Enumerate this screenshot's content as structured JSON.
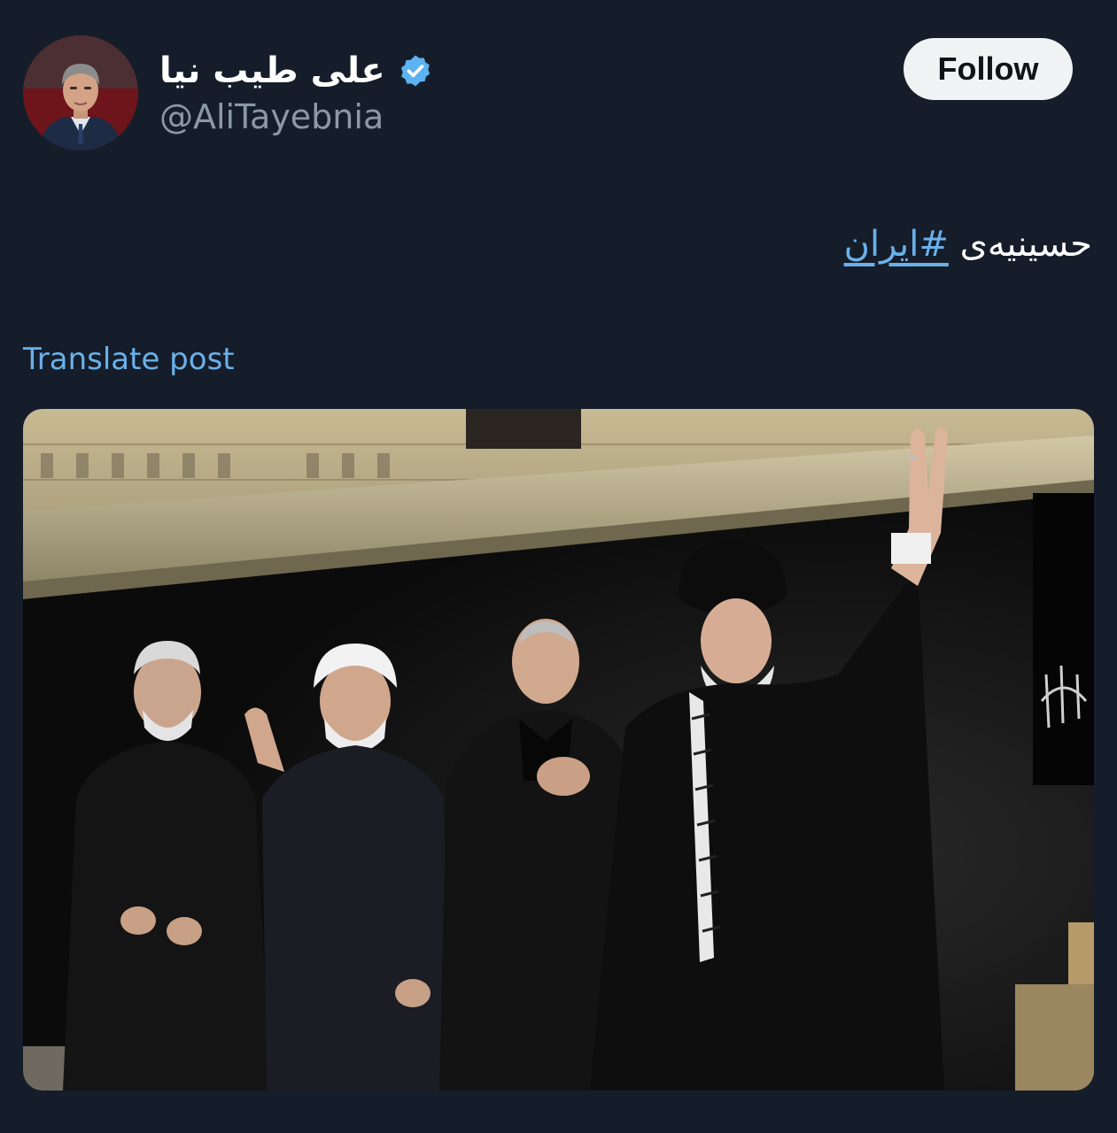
{
  "author": {
    "display_name": "علی طیب نیا",
    "handle": "@AliTayebnia",
    "verified": true,
    "avatar_icon": "profile-photo",
    "verified_icon": "verified-badge-icon"
  },
  "follow_label": "Follow",
  "post": {
    "text_prefix": "حسینیه‌ی",
    "hashtag": "#ایران"
  },
  "translate_label": "Translate post",
  "media": {
    "type": "photo",
    "description_icon": "post-photo"
  },
  "colors": {
    "background": "#151d2b",
    "link": "#6ab1e8",
    "handle": "#8b98a5",
    "verified": "#5cb3f0",
    "follow_bg": "#eff3f4"
  }
}
